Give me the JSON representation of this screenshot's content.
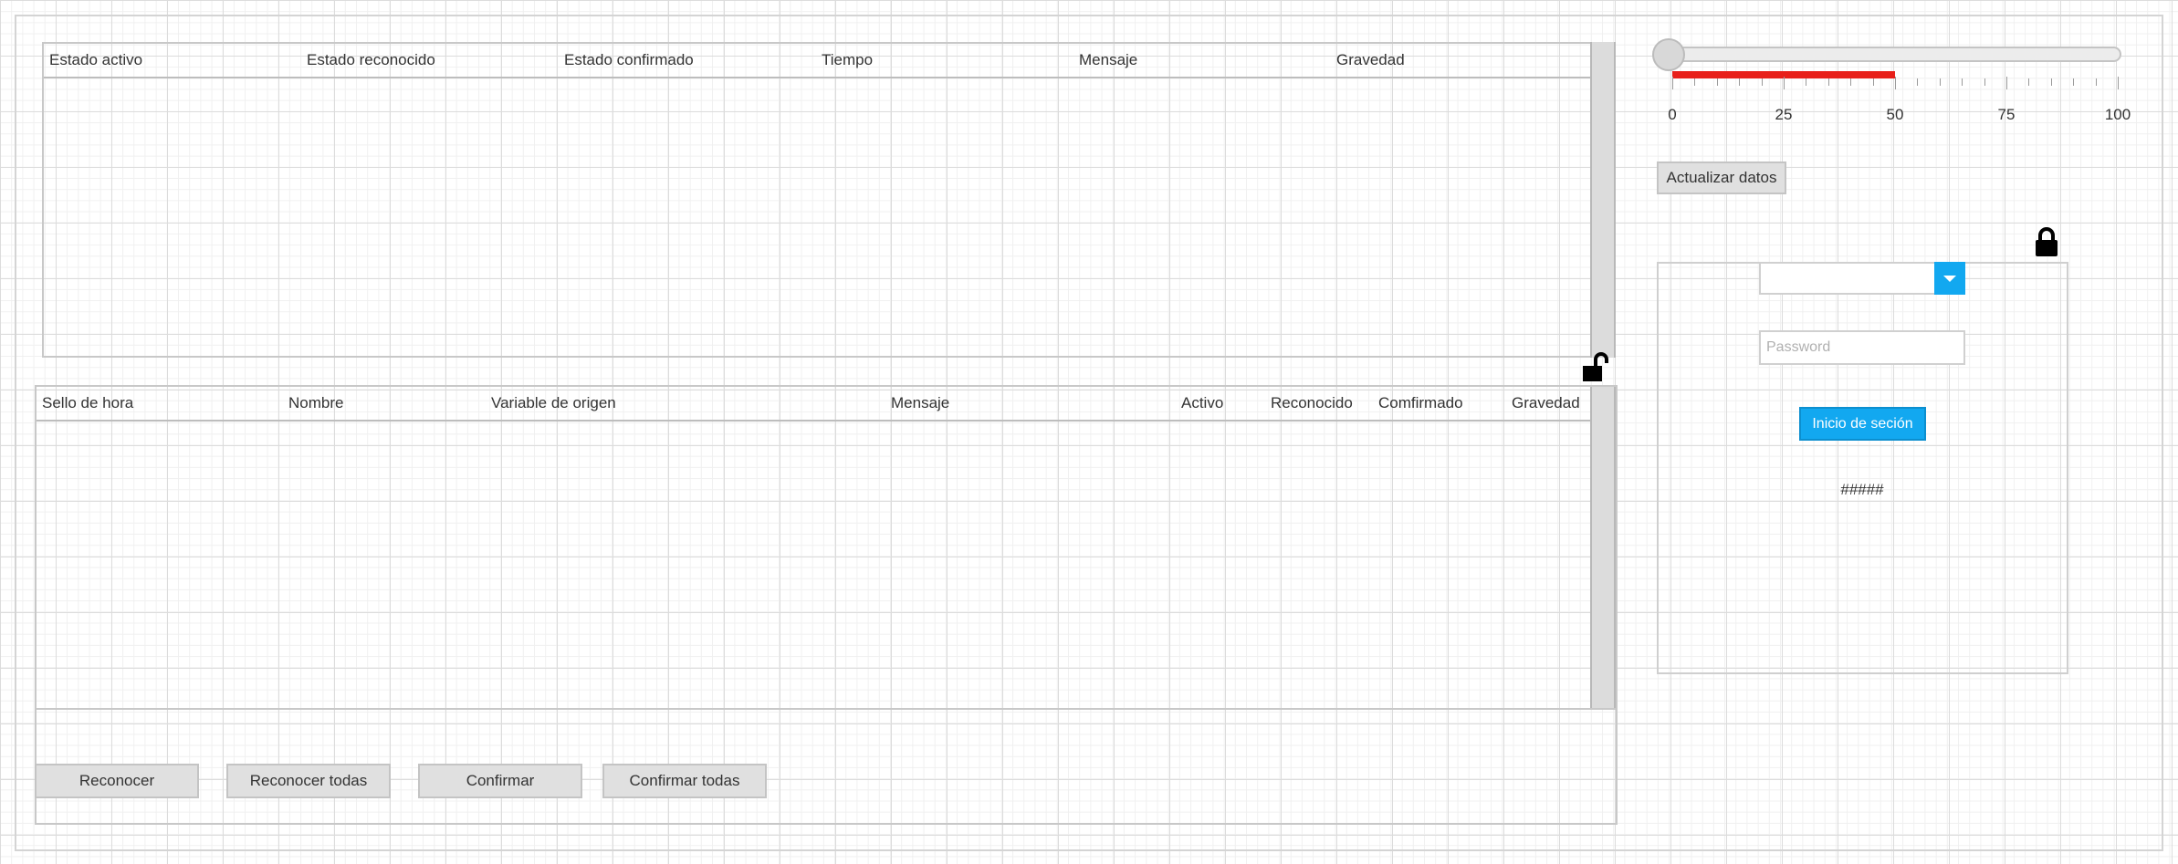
{
  "alarm_summary": {
    "columns": [
      "Estado activo",
      "Estado reconocido",
      "Estado confirmado",
      "Tiempo",
      "Mensaje",
      "Gravedad"
    ]
  },
  "alarm_history": {
    "columns": [
      "Sello de hora",
      "Nombre",
      "Variable de origen",
      "Mensaje",
      "Activo",
      "Reconocido",
      "Comfirmado",
      "Gravedad"
    ]
  },
  "actions": {
    "acknowledge": "Reconocer",
    "acknowledge_all": "Reconocer todas",
    "confirm": "Confirmar",
    "confirm_all": "Confirmar todas"
  },
  "slider": {
    "value": 0,
    "min": 0,
    "max": 100,
    "indicator_value": 50,
    "indicator_color": "#e8201a",
    "labels": [
      "0",
      "25",
      "50",
      "75",
      "100"
    ]
  },
  "refresh_button": "Actualizar datos",
  "login": {
    "user_select_value": "",
    "password_placeholder": "Password",
    "submit_label": "Inicio de seción",
    "status_text": "#####",
    "accent_color": "#12a8f0"
  },
  "icons": {
    "unlocked": "lock-open-icon",
    "locked": "lock-icon",
    "dropdown": "caret-down-icon"
  }
}
